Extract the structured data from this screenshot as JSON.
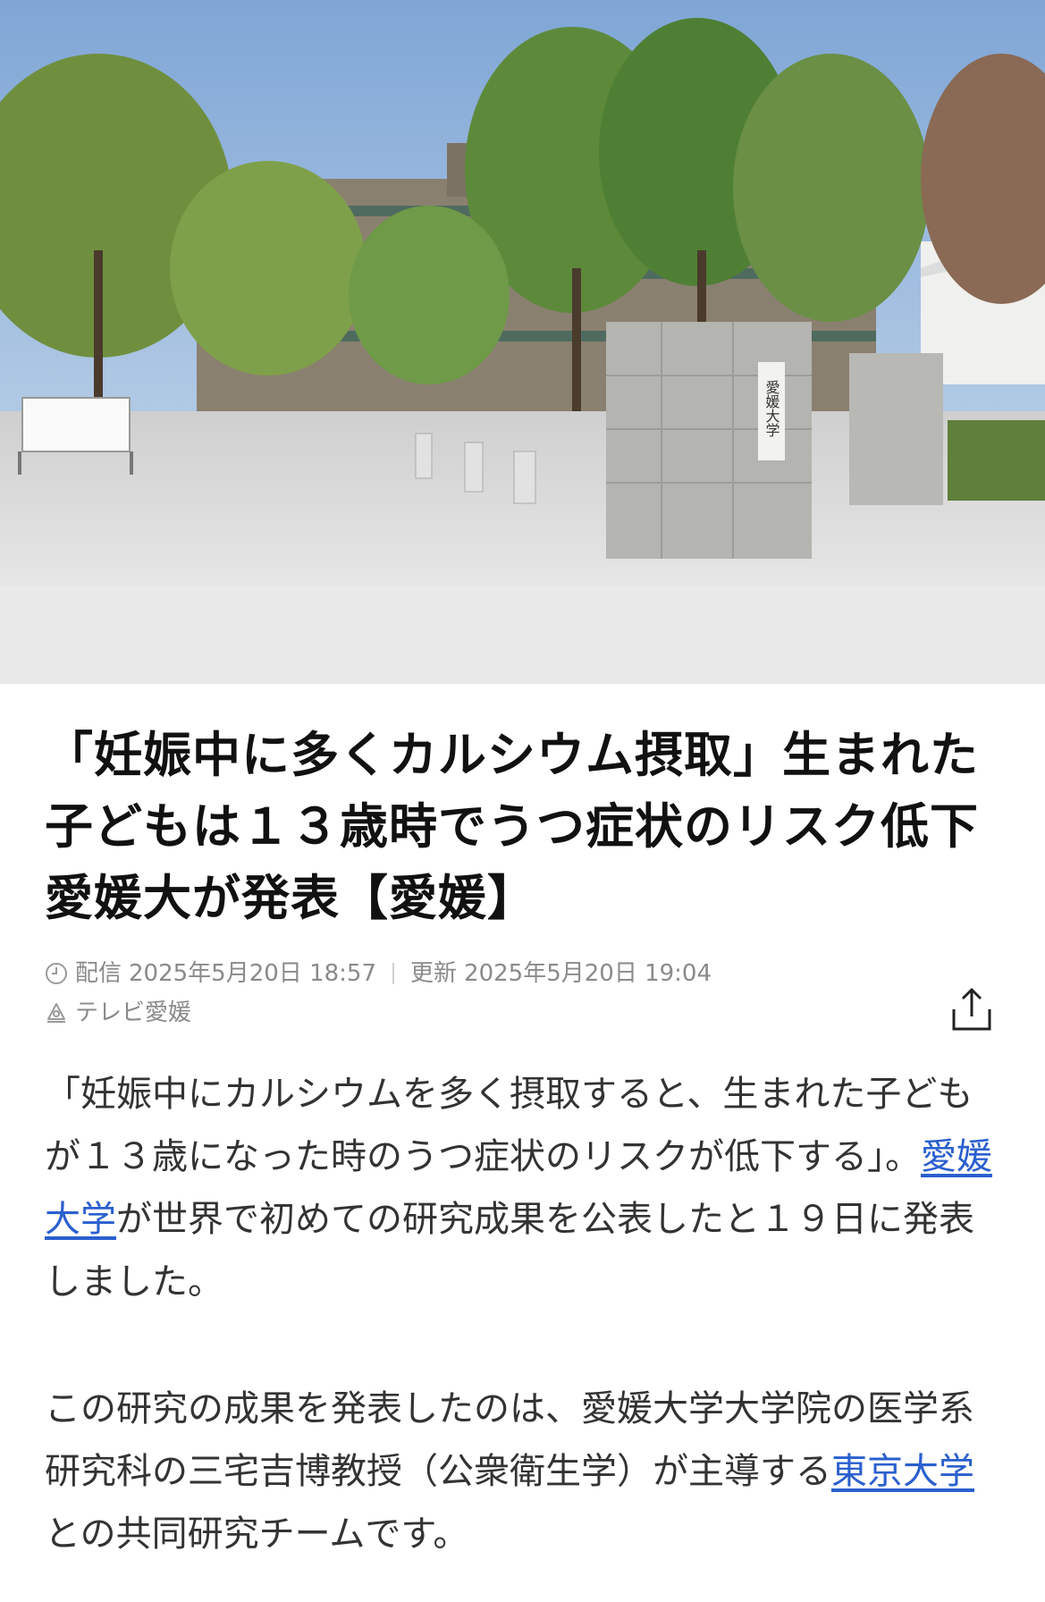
{
  "hero": {
    "image_name": "ehime-university-main-gate-photo",
    "sign_text": "愛媛大学"
  },
  "article": {
    "headline": "「妊娠中に多くカルシウム摂取」生まれた子どもは１３歳時でうつ症状のリスク低下　愛媛大が発表【愛媛】",
    "published_label": "配信",
    "published_date": "2025年5月20日 18:57",
    "updated_label": "更新",
    "updated_date": "2025年5月20日 19:04",
    "source": "テレビ愛媛",
    "paragraph1": {
      "pre": "「妊娠中にカルシウムを多く摂取すると、生まれた子どもが１３歳になった時のうつ症状のリスクが低下する」。",
      "link": "愛媛大学",
      "post": "が世界で初めての研究成果を公表したと１９日に発表しました。"
    },
    "paragraph2": {
      "pre": "この研究の成果を発表したのは、愛媛大学大学院の医学系研究科の三宅吉博教授（公衆衛生学）が主導する",
      "link": "東京大学",
      "post": "との共同研究チームです。"
    }
  },
  "colors": {
    "link": "#2a5fcf",
    "meta_text": "#8a8a8a",
    "headline": "#111111",
    "body": "#333333"
  },
  "icons": [
    "clock-icon",
    "source-icon",
    "share-icon"
  ]
}
